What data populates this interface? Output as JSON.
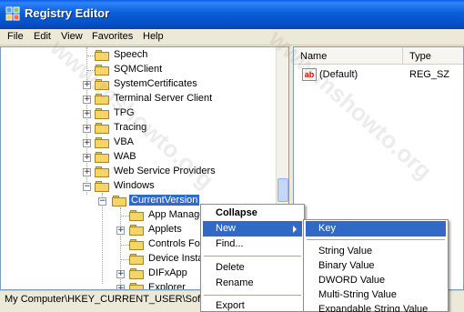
{
  "window": {
    "title": "Registry Editor"
  },
  "menubar": {
    "items": [
      "File",
      "Edit",
      "View",
      "Favorites",
      "Help"
    ]
  },
  "tree": {
    "items": [
      {
        "label": "Speech",
        "expander": ""
      },
      {
        "label": "SQMClient",
        "expander": ""
      },
      {
        "label": "SystemCertificates",
        "expander": "+"
      },
      {
        "label": "Terminal Server Client",
        "expander": "+"
      },
      {
        "label": "TPG",
        "expander": "+"
      },
      {
        "label": "Tracing",
        "expander": "+"
      },
      {
        "label": "VBA",
        "expander": "+"
      },
      {
        "label": "WAB",
        "expander": "+"
      },
      {
        "label": "Web Service Providers",
        "expander": "+"
      },
      {
        "label": "Windows",
        "expander": "−"
      },
      {
        "label": "CurrentVersion",
        "expander": "−"
      },
      {
        "label": "App Manage",
        "expander": ""
      },
      {
        "label": "Applets",
        "expander": "+"
      },
      {
        "label": "Controls Fo",
        "expander": ""
      },
      {
        "label": "Device Insta",
        "expander": ""
      },
      {
        "label": "DIFxApp",
        "expander": "+"
      },
      {
        "label": "Explorer",
        "expander": "+"
      }
    ]
  },
  "list": {
    "columns": [
      "Name",
      "Type"
    ],
    "rows": [
      {
        "name": "(Default)",
        "type": "REG_SZ"
      }
    ]
  },
  "context_menu": {
    "items": [
      "Collapse",
      "New",
      "Find...",
      "Delete",
      "Rename",
      "Export"
    ],
    "highlighted": "New"
  },
  "submenu": {
    "items": [
      "Key",
      "String Value",
      "Binary Value",
      "DWORD Value",
      "Multi-String Value",
      "Expandable String Value"
    ],
    "highlighted": "Key"
  },
  "statusbar": {
    "path": "My Computer\\HKEY_CURRENT_USER\\Software"
  },
  "watermark": {
    "text": "www.mshowto.org"
  },
  "colors": {
    "selection": "#316ac5",
    "titlebar": "#0b5fd8"
  }
}
